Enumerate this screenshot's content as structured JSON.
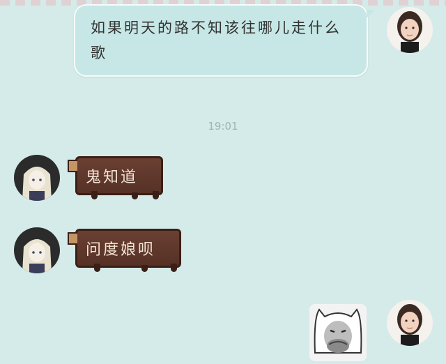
{
  "chat": {
    "outgoing_message": "如果明天的路不知该往哪儿走什么歌",
    "timestamp": "19:01",
    "incoming_1": "鬼知道",
    "incoming_2": "问度娘呗"
  },
  "colors": {
    "background": "#d4ebe9",
    "outgoing_bubble": "#c6e7e5",
    "chocolate_bubble": "#563126",
    "timestamp_text": "#a3b3b2"
  },
  "icons": {
    "self_avatar": "girl-photo-avatar",
    "friend_avatar": "anime-girl-avatar",
    "sticker": "covering-mouth-meme-sticker"
  }
}
